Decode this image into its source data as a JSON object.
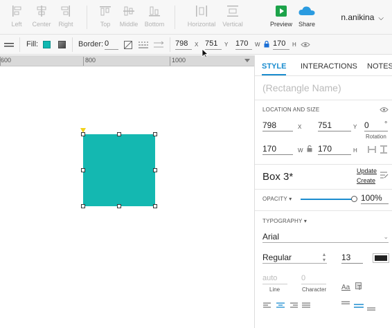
{
  "toolbar": {
    "align_left": "Left",
    "align_center": "Center",
    "align_right": "Right",
    "align_top": "Top",
    "align_middle": "Middle",
    "align_bottom": "Bottom",
    "distribute_horizontal": "Horizontal",
    "distribute_vertical": "Vertical",
    "preview": "Preview",
    "share": "Share",
    "username": "n.anikina"
  },
  "formatbar": {
    "fill_label": "Fill:",
    "border_label": "Border:",
    "border_value": "0",
    "x_value": "798",
    "x_label": "X",
    "y_value": "751",
    "y_label": "Y",
    "w_value": "170",
    "w_label": "W",
    "h_value": "170",
    "h_label": "H"
  },
  "ruler": {
    "labels": [
      "600",
      "800",
      "1000"
    ]
  },
  "panel": {
    "tabs": {
      "style": "STYLE",
      "interactions": "INTERACTIONS",
      "notes": "NOTES"
    },
    "name_placeholder": "(Rectangle Name)",
    "location_header": "LOCATION AND SIZE",
    "x": "798",
    "x_label": "X",
    "y": "751",
    "y_label": "Y",
    "rotation": "0",
    "rotation_unit": "°",
    "rotation_label": "Rotation",
    "w": "170",
    "w_label": "W",
    "h": "170",
    "h_label": "H",
    "style_name": "Box 3*",
    "update_link": "Update",
    "create_link": "Create",
    "opacity_label": "OPACITY",
    "opacity_value": "100%",
    "opacity_level": 1.0,
    "typography_label": "TYPOGRAPHY",
    "font_family": "Arial",
    "font_weight": "Regular",
    "font_size": "13",
    "line_value": "auto",
    "line_label": "Line",
    "character_value": "0",
    "character_label": "Character",
    "text_color": "#222222"
  },
  "colors": {
    "accent": "#1a8ccf",
    "shape_fill": "#14b8b1",
    "preview_green": "#1da34a",
    "share_blue": "#2b9be0"
  }
}
